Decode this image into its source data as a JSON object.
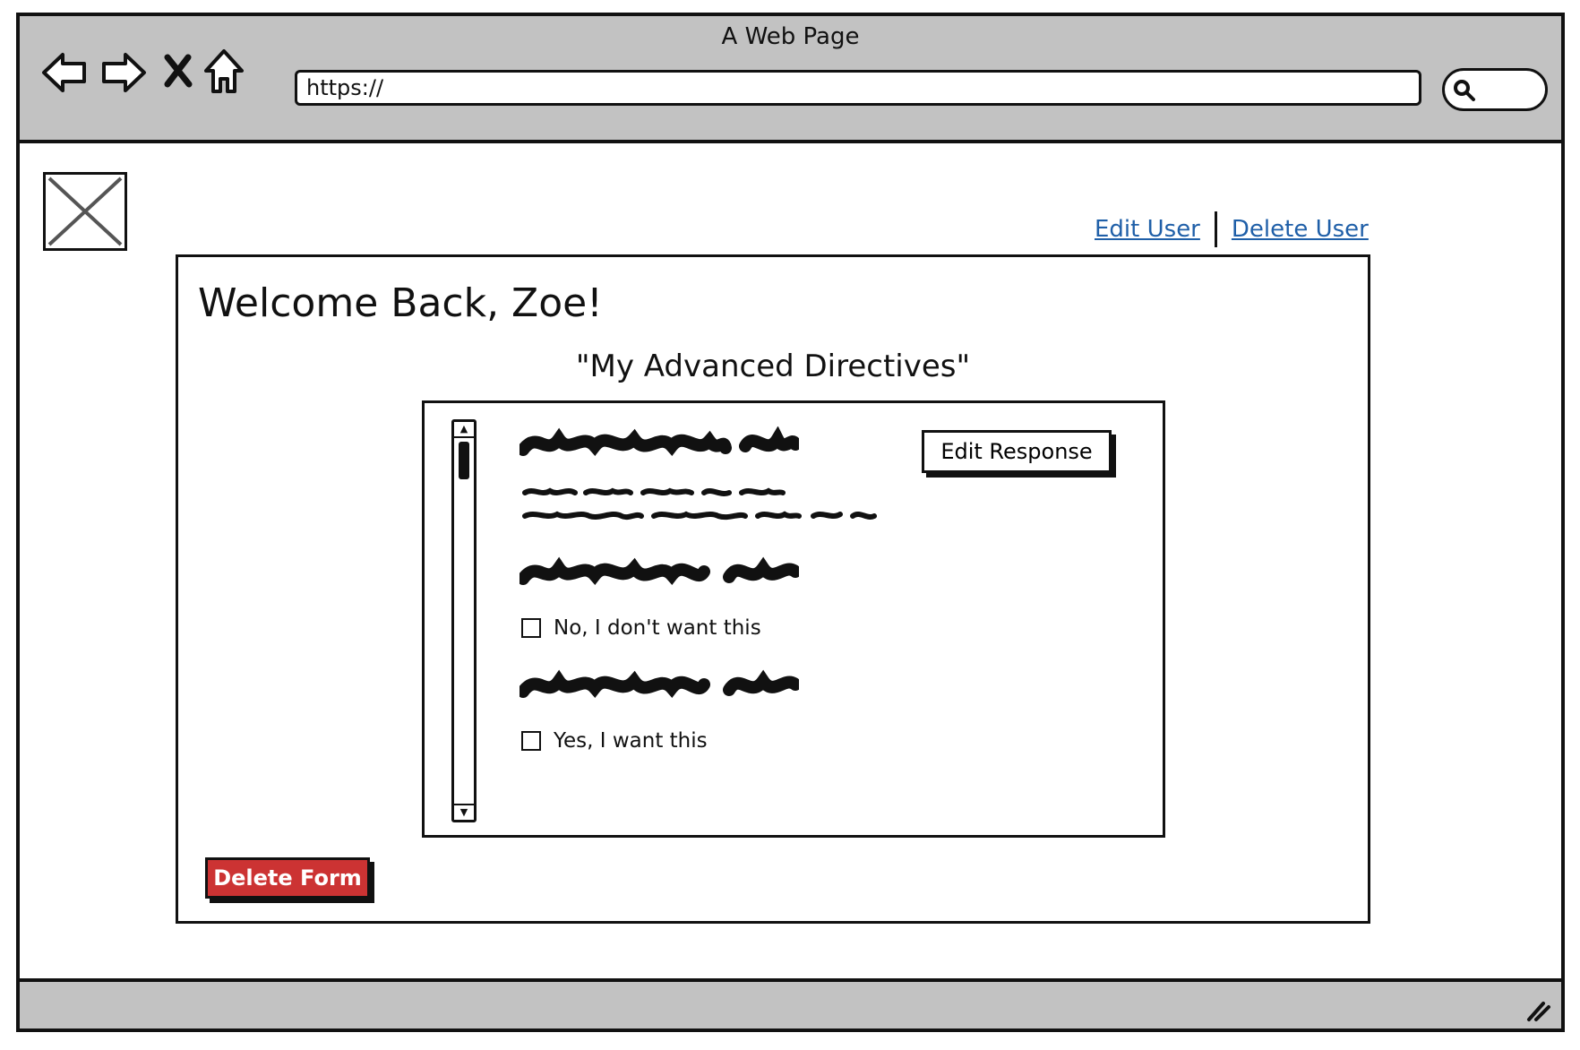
{
  "window": {
    "title": "A Web Page"
  },
  "toolbar": {
    "back_icon": "back-arrow-icon",
    "forward_icon": "forward-arrow-icon",
    "stop_icon": "close-icon",
    "home_icon": "home-icon",
    "url": "https://",
    "search_icon": "search-icon"
  },
  "user_links": {
    "edit_user": "Edit User",
    "delete_user": "Delete User"
  },
  "panel": {
    "welcome": "Welcome Back, Zoe!",
    "form_title": "\"My Advanced Directives\"",
    "edit_response_label": "Edit Response",
    "options": [
      {
        "label": "No, I don't want this",
        "checked": false
      },
      {
        "label": "Yes, I want this",
        "checked": false
      }
    ],
    "delete_form_label": "Delete Form"
  },
  "colors": {
    "chrome": "#c2c2c2",
    "link": "#1f5fa8",
    "danger": "#cc3333"
  }
}
